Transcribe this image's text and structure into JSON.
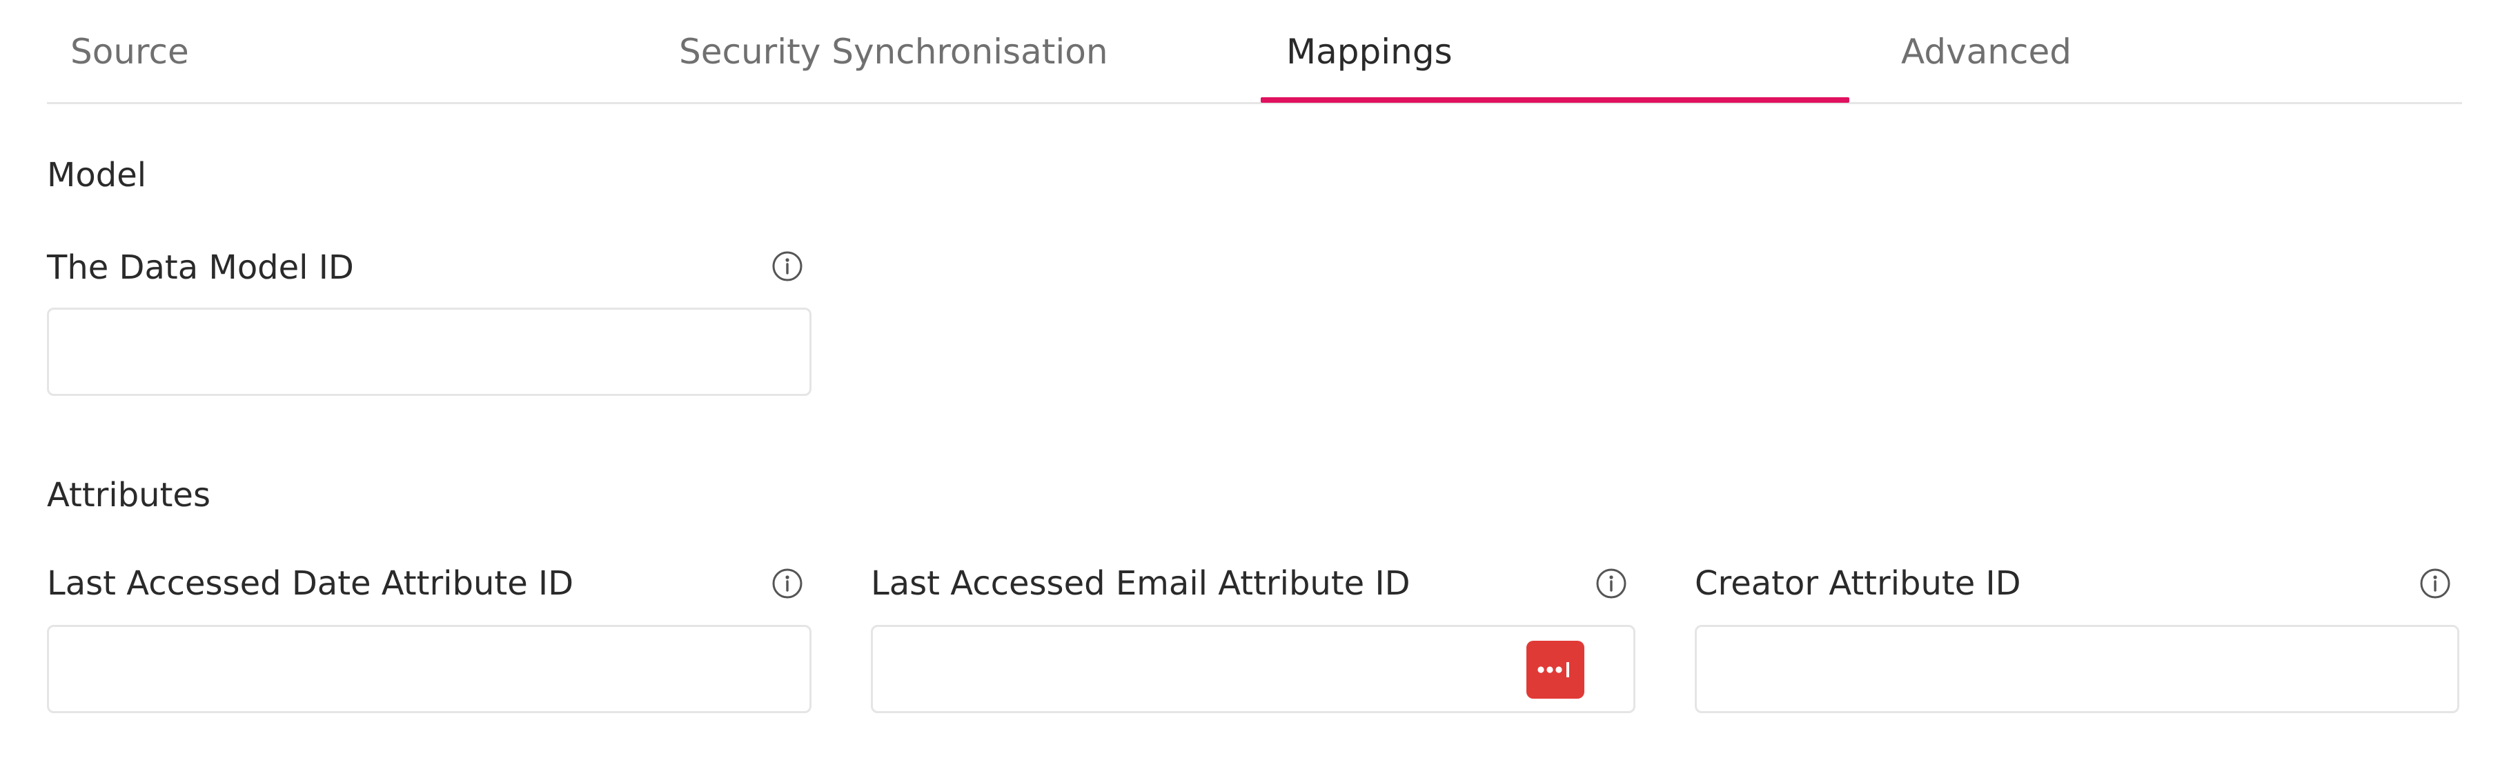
{
  "tabs": [
    {
      "label": "Source",
      "active": false
    },
    {
      "label": "Security Synchronisation",
      "active": false
    },
    {
      "label": "Mappings",
      "active": true
    },
    {
      "label": "Advanced",
      "active": false
    }
  ],
  "colors": {
    "accent": "#e0115f",
    "password_manager_badge": "#e03a37",
    "border": "#e5e5e5"
  },
  "model_section": {
    "heading": "Model",
    "data_model_id": {
      "label": "The Data Model ID",
      "value": "",
      "info_icon": "info-icon"
    }
  },
  "attributes_section": {
    "heading": "Attributes",
    "last_accessed_date": {
      "label": "Last Accessed Date Attribute ID",
      "value": "",
      "info_icon": "info-icon"
    },
    "last_accessed_email": {
      "label": "Last Accessed Email Attribute ID",
      "value": "",
      "info_icon": "info-icon",
      "field_badge_icon": "password-manager-icon"
    },
    "creator": {
      "label": "Creator Attribute ID",
      "value": "",
      "info_icon": "info-icon"
    }
  }
}
